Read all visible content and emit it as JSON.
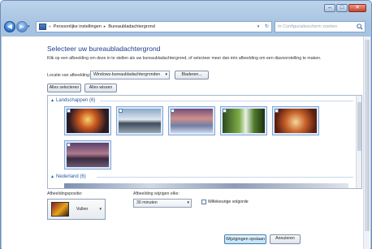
{
  "window": {
    "minimize": "–",
    "maximize": "□",
    "close": "✕"
  },
  "nav": {
    "back": "◀",
    "forward": "▶",
    "breadcrumb": [
      "Persoonlijke instellingen",
      "Bureaubladachtergrond"
    ],
    "search_placeholder": "In Configuratiescherm zoeken"
  },
  "main": {
    "title": "Selecteer uw bureaubladachtergrond",
    "description": "Klik op een afbeelding om deze in te stellen als uw bureaubladachtergrond, of selecteer meer dan één afbeelding om een diavoorstelling te maken.",
    "location_label": "Locatie van afbeelding:",
    "location_value": "Windows-bureaubladachtergronden",
    "browse_label": "Bladeren...",
    "select_all_label": "Alles selecteren",
    "clear_all_label": "Alles wissen"
  },
  "gallery": {
    "groups": [
      {
        "label": "Landschappen (6)"
      },
      {
        "label": "Nederland (6)"
      }
    ]
  },
  "options": {
    "position_label": "Afbeeldingspositie:",
    "position_value": "Vullen",
    "interval_label": "Afbeelding wijzigen elke:",
    "interval_value": "30 minuten",
    "shuffle_label": "Willekeurige volgorde"
  },
  "footer": {
    "save_label": "Wijzigingen opslaan",
    "cancel_label": "Annuleren"
  }
}
